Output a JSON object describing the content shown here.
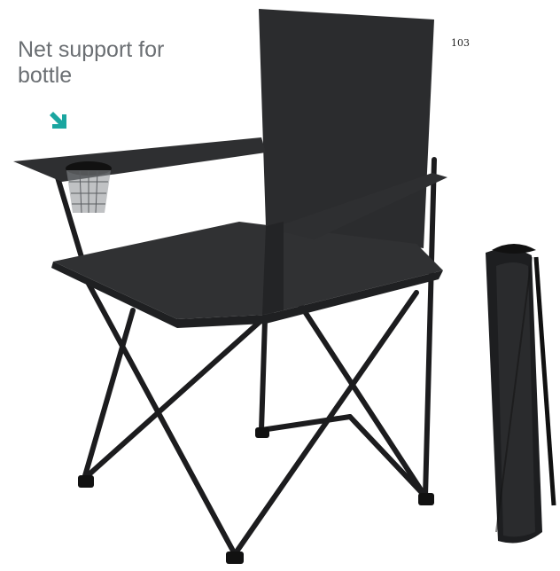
{
  "caption": {
    "line1": "Net support for",
    "line2": "bottle"
  },
  "page_number": "103",
  "colors": {
    "accent": "#1aa6a0",
    "fabric": "#2b2c2e",
    "frame": "#1c1c1e"
  },
  "icons": {
    "pointer": "arrow-down-right-icon"
  }
}
